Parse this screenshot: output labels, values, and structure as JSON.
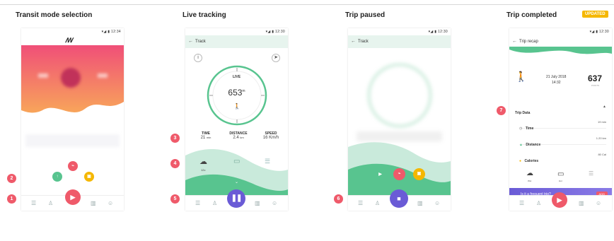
{
  "panels": [
    {
      "title": "Transit mode selection"
    },
    {
      "title": "Live tracking"
    },
    {
      "title": "Trip paused"
    },
    {
      "title": "Trip completed",
      "badge": "UPDATED"
    }
  ],
  "status_time": {
    "p1": "12:34",
    "p2": "12:30",
    "p3": "12:30",
    "p4": "12:30"
  },
  "callouts": [
    "1",
    "2",
    "3",
    "4",
    "5",
    "6",
    "7"
  ],
  "live": {
    "appbar_title": "Track",
    "live_label": "LIVE",
    "value": "653",
    "unit": "m",
    "stats": [
      {
        "label": "TIME",
        "value": "21",
        "unit": "min"
      },
      {
        "label": "DISTANCE",
        "value": "2.4",
        "unit": "km"
      },
      {
        "label": "SPEED",
        "value": "16 Km/h"
      }
    ],
    "weather_label": "12c"
  },
  "paused": {
    "appbar_title": "Track"
  },
  "completed": {
    "appbar_title": "Trip recap",
    "date": "21 July 2018",
    "time": "14:32",
    "score": "637",
    "score_label": "POINTS",
    "section_title": "Trip Data",
    "rows": [
      {
        "label": "Time",
        "value": "19 min"
      },
      {
        "label": "Distance",
        "value": "1.20 km"
      },
      {
        "label": "Calories",
        "value": "80 Cal"
      }
    ],
    "icon_labels": [
      "Wet",
      "Hot"
    ],
    "banner_text": "Is it a frequent trip?",
    "banner_button": "ADD"
  },
  "colors": {
    "accent_red": "#ef5a6a",
    "green": "#58c48f",
    "purple": "#6a5bd6",
    "yellow": "#f5b700"
  }
}
